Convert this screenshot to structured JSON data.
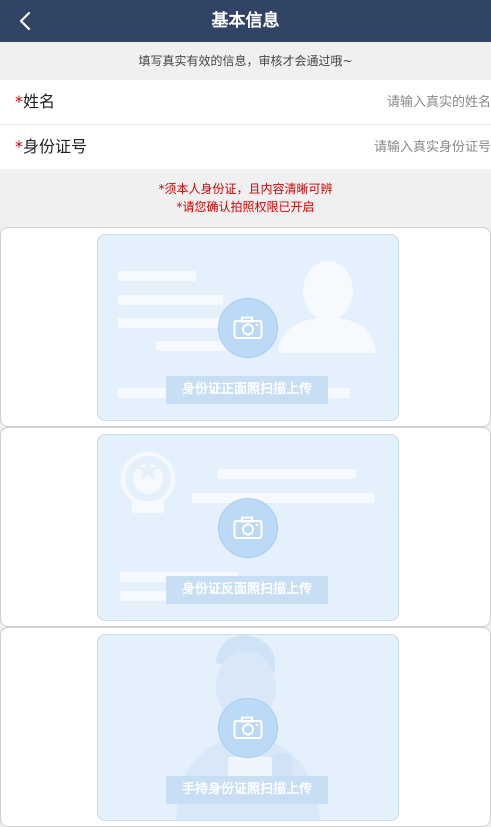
{
  "header": {
    "title": "基本信息"
  },
  "notice": "填写真实有效的信息，审核才会通过哦~",
  "form": {
    "required_mark": "*",
    "name": {
      "label": "姓名",
      "placeholder": "请输入真实的姓名"
    },
    "id_number": {
      "label": "身份证号",
      "placeholder": "请输入真实身份证号"
    }
  },
  "warnings": [
    "*须本人身份证，且内容清晰可辨",
    "*请您确认拍照权限已开启"
  ],
  "uploads": {
    "front": "身份证正面照扫描上传",
    "back": "身份证反面照扫描上传",
    "handheld": "手持身份证照扫描上传"
  },
  "colors": {
    "header_bg": "#314466",
    "required": "#d40000",
    "upload_tint": "#e4f0fc"
  },
  "icons": [
    "back-icon",
    "camera-icon",
    "avatar-silhouette-icon",
    "national-emblem-icon",
    "person-holding-id-icon"
  ]
}
